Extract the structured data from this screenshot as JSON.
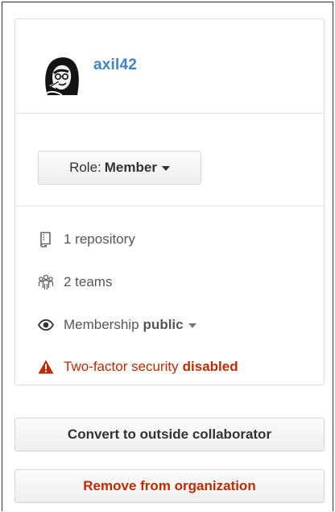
{
  "member": {
    "username": "axil42",
    "avatar_icon": "avatar-image"
  },
  "role": {
    "label": "Role:",
    "value": "Member",
    "dropdown_icon": "caret-down-icon"
  },
  "stats": {
    "repositories": "1 repository",
    "repositories_icon": "repo-icon",
    "teams": "2 teams",
    "teams_icon": "organization-icon"
  },
  "membership": {
    "label": "Membership",
    "value": "public",
    "icon": "eye-icon"
  },
  "two_factor": {
    "label": "Two-factor security",
    "value": "disabled",
    "icon": "alert-icon",
    "color": "#bd2c00"
  },
  "actions": {
    "convert_label": "Convert to outside collaborator",
    "remove_label": "Remove from organization",
    "remove_color": "#bd2c00"
  },
  "colors": {
    "link": "#4183c4",
    "text": "#333333",
    "muted": "#555555",
    "border": "#dddddd"
  }
}
